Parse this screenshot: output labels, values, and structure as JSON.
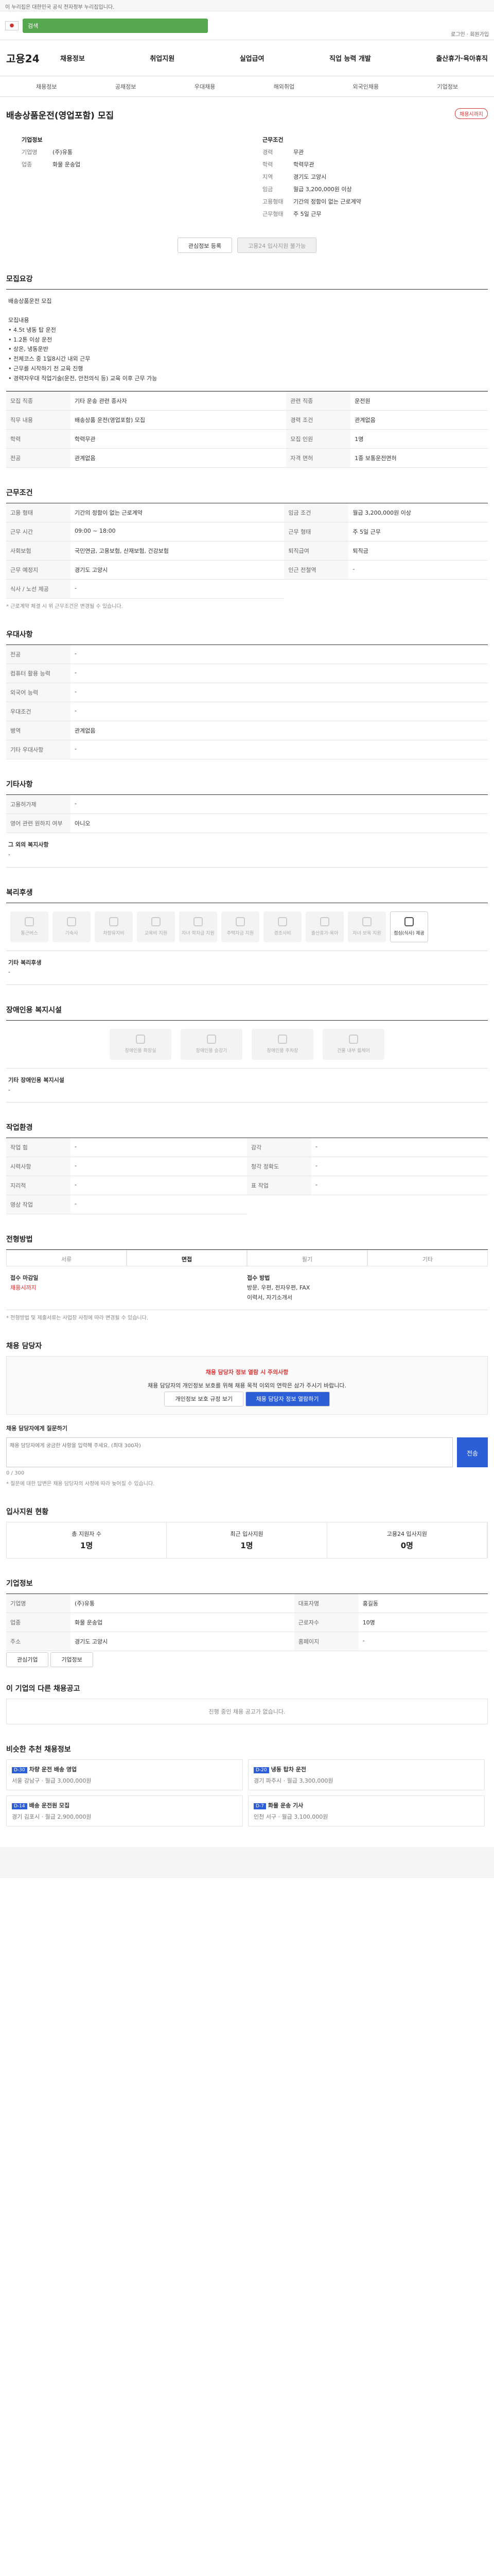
{
  "top": {
    "notice": "이 누리집은 대한민국 공식 전자정부 누리집입니다."
  },
  "gov": {
    "search": "검색",
    "links": "로그인 · 회원가입"
  },
  "gnb": {
    "logo": "고용24",
    "menu": [
      "채용정보",
      "취업지원",
      "실업급여",
      "직업 능력 개발",
      "출산휴가·육아휴직"
    ]
  },
  "sub": [
    "채용정보",
    "공채정보",
    "우대채용",
    "해외취업",
    "외국인채용",
    "기업정보"
  ],
  "job": {
    "title": "배송상품운전(영업포함) 모집",
    "status": "채용시까지",
    "company_h": "기업정보",
    "cond_h": "근무조건",
    "company": [
      [
        "기업명",
        "(주)유통"
      ],
      [
        "업종",
        "화물 운송업"
      ]
    ],
    "cond": [
      [
        "경력",
        "무관"
      ],
      [
        "학력",
        "학력무관"
      ],
      [
        "지역",
        "경기도 고양시"
      ],
      [
        "임금",
        "월급 3,200,000원 이상"
      ],
      [
        "고용형태",
        "기간의 정함이 없는 근로계약"
      ],
      [
        "근무형태",
        "주 5일 근무"
      ]
    ],
    "btn_scrap": "관심정보 등록",
    "btn_apply": "고용24 입사지원 불가능"
  },
  "recruit": {
    "h": "모집요강",
    "content": "배송상품운전 모집\n\n모집내용\n• 4.5t 냉동 탑 운전\n• 1.2톤 이상 운전\n• 상온, 냉동운반\n• 전체코스 중 1일8시간 내외 근무\n• 근무를 시작하기 전 교육 진행\n• 경력자우대 직업기술(운전, 안전의식 등) 교육 이후 근무 가능",
    "rows": [
      [
        "모집 직종",
        "기타 운송 관련 종사자"
      ],
      [
        "관련 직종",
        "운전원"
      ],
      [
        "직무 내용",
        "배송상품 운전(영업포함) 모집"
      ],
      [
        "경력 조건",
        "관계없음"
      ],
      [
        "학력",
        "학력무관"
      ],
      [
        "모집 인원",
        "1명"
      ],
      [
        "전공",
        "관계없음"
      ],
      [
        "자격 면허",
        "1종 보통운전면허"
      ]
    ]
  },
  "work": {
    "h": "근무조건",
    "rows": [
      [
        "고용 형태",
        "기간의 정함이 없는 근로계약"
      ],
      [
        "임금 조건",
        "월급 3,200,000원 이상"
      ],
      [
        "근무 시간",
        "09:00 ~ 18:00"
      ],
      [
        "근무 형태",
        "주 5일 근무"
      ],
      [
        "사회보험",
        "국민연금, 고용보험, 산재보험, 건강보험"
      ],
      [
        "퇴직급여",
        "퇴직금"
      ],
      [
        "근무 예정지",
        "경기도 고양시"
      ],
      [
        "인근 전철역",
        "-"
      ],
      [
        "식사 / 노선 제공",
        "-"
      ]
    ],
    "note": "* 근로계약 체결 시 위 근무조건은 변경될 수 있습니다."
  },
  "pref": {
    "h": "우대사항",
    "rows": [
      [
        "전공",
        "-"
      ],
      [
        "컴퓨터 활용 능력",
        "-"
      ],
      [
        "외국어 능력",
        "-"
      ],
      [
        "우대조건",
        "-"
      ],
      [
        "병역",
        "관계없음"
      ],
      [
        "기타 우대사항",
        "-"
      ]
    ]
  },
  "etc": {
    "h": "기타사항",
    "rows": [
      [
        "고용허가제",
        "-"
      ],
      [
        "영어 관련 원하지 여부",
        "아니오"
      ]
    ],
    "more_h": "그 외의 복지사항",
    "more": "-"
  },
  "welfare": {
    "h": "복리후생",
    "items": [
      "통근버스",
      "기숙사",
      "차량유지비",
      "교육비 지원",
      "자녀 학자금 지원",
      "주택자금 지원",
      "경조사비",
      "출산휴가·육아",
      "자녀 보육 지원",
      "점심(식사) 제공"
    ],
    "other_h": "기타 복리후생",
    "other": "-"
  },
  "disabled": {
    "h": "장애인용 복지시설",
    "items": [
      "장애인용 화장실",
      "장애인용 승강기",
      "장애인용 주차장",
      "건물 내부 휠체어"
    ],
    "other_h": "기타 장애인용 복지시설",
    "other": "-"
  },
  "career_env": {
    "h": "작업환경",
    "rows": [
      [
        "작업 힘",
        "-"
      ],
      [
        "감각",
        "-"
      ],
      [
        "시력사항",
        "-"
      ],
      [
        "청각 정확도",
        "-"
      ],
      [
        "지리적",
        "-"
      ],
      [
        "표 작업",
        "-"
      ],
      [
        "영상 작업",
        "-"
      ]
    ]
  },
  "method": {
    "h": "전형방법",
    "opts": [
      "서류",
      "면접",
      "필기",
      "기타"
    ],
    "apply_h": "접수 마감일",
    "deadline": "채용시까지",
    "apply_way_h": "접수 방법",
    "apply_way": "방문, 우편, 전자우편, FAX",
    "docs": "이력서, 자기소개서",
    "note": "* 전형방법 및 제출서류는 사업장 사정에 따라 변경될 수 있습니다."
  },
  "manager": {
    "h": "채용 담당자",
    "alert": "채용 담당자 정보 열람 시 주의사항",
    "text": "채용 담당자의 개인정보 보호를 위해 채용 목적 이외의 연락은 삼가 주시기 바랍니다.",
    "btn1": "개인정보 보호 규정 보기",
    "btn2": "채용 담당자 정보 열람하기"
  },
  "qna": {
    "h": "채용 담당자에게 질문하기",
    "placeholder": "채용 담당자에게 궁금한 사항을 입력해 주세요. (최대 300자)",
    "send": "전송",
    "count": "0 / 300",
    "note": "* 질문에 대한 답변은 채용 담당자의 사정에 따라 늦어질 수 있습니다."
  },
  "status": {
    "h": "입사지원 현황",
    "cells": [
      [
        "총 지원자 수",
        "1명"
      ],
      [
        "최근 입사지원",
        "1명"
      ],
      [
        "고용24 입사지원",
        "0명"
      ]
    ]
  },
  "corp": {
    "h": "기업정보",
    "rows": [
      [
        "기업명",
        "(주)유통"
      ],
      [
        "대표자명",
        "홍길동"
      ],
      [
        "업종",
        "화물 운송업"
      ],
      [
        "근로자수",
        "10명"
      ],
      [
        "주소",
        "경기도 고양시"
      ],
      [
        "홈페이지",
        "-"
      ]
    ],
    "btn1": "관심기업",
    "btn2": "기업정보"
  },
  "other_jobs": {
    "h": "이 기업의 다른 채용공고",
    "empty": "진행 중인 채용 공고가 없습니다."
  },
  "recommend": {
    "h": "비슷한 추천 채용정보",
    "cards": [
      [
        "D-30",
        "차량 운전 배송 영업",
        "서울 강남구",
        "월급 3,000,000원"
      ],
      [
        "D-20",
        "냉동 탑차 운전",
        "경기 파주시",
        "월급 3,300,000원"
      ],
      [
        "D-14",
        "배송 운전원 모집",
        "경기 김포시",
        "월급 2,900,000원"
      ],
      [
        "D-7",
        "화물 운송 기사",
        "인천 서구",
        "월급 3,100,000원"
      ]
    ]
  }
}
